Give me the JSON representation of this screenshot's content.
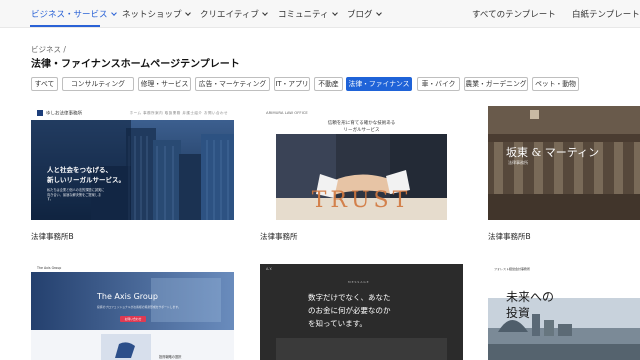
{
  "nav": {
    "items": [
      {
        "label": "ビジネス・サービス",
        "active": true
      },
      {
        "label": "ネットショップ",
        "active": false
      },
      {
        "label": "クリエイティブ",
        "active": false
      },
      {
        "label": "コミュニティ",
        "active": false
      },
      {
        "label": "ブログ",
        "active": false
      }
    ],
    "all_templates": "すべてのテンプレート",
    "blank_templates": "白紙テンプレート"
  },
  "breadcrumb": "ビジネス /",
  "page_title": "法律・ファイナンスホームページテンプレート",
  "filters": [
    {
      "label": "すべて",
      "active": false
    },
    {
      "label": "コンサルティング",
      "active": false
    },
    {
      "label": "修理・サービス",
      "active": false
    },
    {
      "label": "広告・マーケティング",
      "active": false
    },
    {
      "label": "IT・アプリ",
      "active": false
    },
    {
      "label": "不動産",
      "active": false
    },
    {
      "label": "法律・ファイナンス",
      "active": true
    },
    {
      "label": "車・バイク",
      "active": false
    },
    {
      "label": "農業・ガーデニング",
      "active": false
    },
    {
      "label": "ペット・動物",
      "active": false
    }
  ],
  "cards": [
    {
      "label": "法律事務所B",
      "thumb": {
        "logo": "ゆしお法律事務所",
        "nav_links": "ホーム   事務所案内   取扱業務   弁護士紹介   お問い合わせ",
        "headline1": "人と社会をつなげる、",
        "headline2": "新しいリーガルサービス。",
        "body": "私たちは企業と個人の法的課題に誠実に向き合い、最適な解決策をご提案します。"
      }
    },
    {
      "label": "法律事務所",
      "thumb": {
        "logo": "ARIMURA LAW OFFICE",
        "tagline1": "信頼を形に育てる確かな技術ある",
        "tagline2": "リーガルサービス",
        "big_word": "TRUST"
      }
    },
    {
      "label": "法律事務所B",
      "thumb": {
        "title": "坂東 & マーティン",
        "subtitle": "法律事務所"
      }
    },
    {
      "label": "",
      "thumb": {
        "logo": "The Axis Group",
        "headline": "The Axis Group",
        "body": "投資のプロフェッショナルがお客様の資産形成をサポートします。",
        "button": "お問い合わせ",
        "section": "投資戦略の選択"
      }
    },
    {
      "label": "",
      "thumb": {
        "logo": "A.Y.",
        "small": "MESSAGE",
        "line1": "数字だけでなく、あなた",
        "line2": "のお金に何が必要なのか",
        "line3": "を知っています。"
      }
    },
    {
      "label": "",
      "thumb": {
        "logo": "フォレスト経営会計事務所",
        "line1": "未来への",
        "line2": "投資"
      }
    }
  ],
  "colors": {
    "accent": "#1f63d8",
    "nav_active": "#2a62d6",
    "trust_orange": "#d2783f"
  }
}
